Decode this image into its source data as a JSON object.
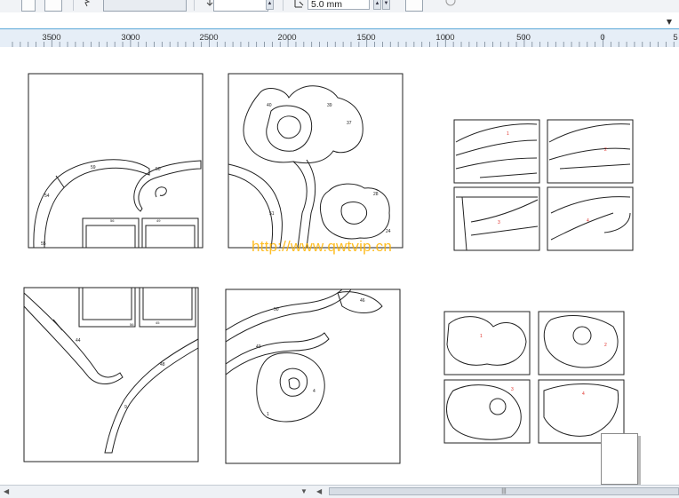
{
  "toolbar": {
    "nudge_value": "5.0 mm"
  },
  "ruler": {
    "labels": [
      "3500",
      "3000",
      "2500",
      "2000",
      "1500",
      "1000",
      "500",
      "0",
      "5"
    ]
  },
  "watermark": {
    "text": "http://www.qwtvip.cn"
  },
  "panels": {
    "scroll_left": {
      "labels": [
        "59",
        "50",
        "54",
        "55",
        "56",
        "49",
        "53",
        "54",
        "60"
      ]
    },
    "rose_large": {
      "labels": [
        "40",
        "41",
        "42",
        "43",
        "39",
        "37",
        "36",
        "52",
        "51",
        "29",
        "28",
        "26",
        "23",
        "24",
        "25",
        "27",
        "33",
        "32",
        "34"
      ]
    },
    "vine_corner": {
      "labels": [
        "44",
        "48",
        "56",
        "45",
        "9"
      ]
    },
    "rose_small": {
      "labels": [
        "50",
        "46",
        "43",
        "44",
        "14",
        "13",
        "12",
        "4",
        "3",
        "2",
        "1"
      ]
    }
  },
  "thumbnails": {
    "group1": [
      "1",
      "2",
      "3",
      "4"
    ],
    "group2": [
      "1",
      "2",
      "3",
      "4"
    ]
  },
  "statusbar": {
    "thumb_grip": "|||"
  },
  "colors": {
    "ruler_bg": "#e6eef7",
    "accent_line": "#5aa8d8",
    "watermark": "#ffb300",
    "thumb_label": "#e0302a"
  }
}
